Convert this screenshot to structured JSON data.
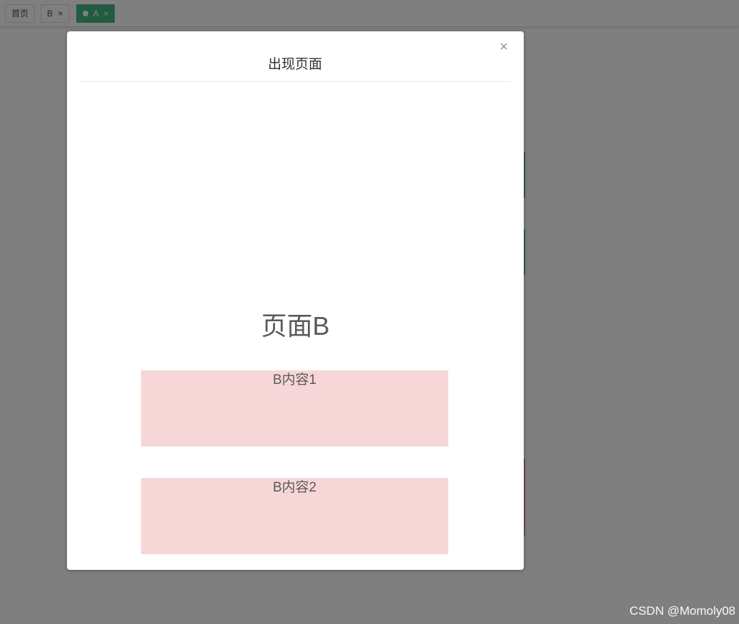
{
  "tabs": [
    {
      "label": "首页",
      "closable": false,
      "active": false
    },
    {
      "label": "B",
      "closable": true,
      "active": false
    },
    {
      "label": "A",
      "closable": true,
      "active": true
    }
  ],
  "close_glyph": "×",
  "dialog": {
    "title": "出现页面",
    "close_glyph": "×",
    "heading": "页面B",
    "boxes": [
      {
        "label": "B内容1"
      },
      {
        "label": "B内容2"
      }
    ]
  },
  "watermark": "CSDN @Momoly08",
  "colors": {
    "overlay": "rgba(0,0,0,0.5)",
    "active_tab": "#42b983",
    "content_box": "#f7d6d7"
  }
}
